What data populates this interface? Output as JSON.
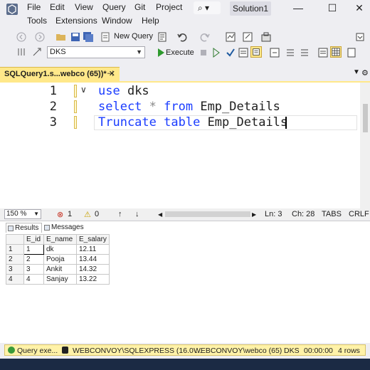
{
  "menu": {
    "items": [
      "File",
      "Edit",
      "View",
      "Query",
      "Git",
      "Project",
      "Tools",
      "Extensions",
      "Window",
      "Help"
    ],
    "search_label": "⌕ ▾",
    "solution_name": "Solution1"
  },
  "window": {
    "minimize": "—",
    "maximize": "☐",
    "close": "✕"
  },
  "toolbar": {
    "new_query_label": "New Query",
    "database_selected": "DKS",
    "execute_label": "Execute"
  },
  "tab": {
    "title": "SQLQuery1.s...webco (65))*",
    "pin": "⊣",
    "close": "✕"
  },
  "editor": {
    "lines": [
      {
        "number": "1",
        "keyword": "use",
        "rest": " dks"
      },
      {
        "number": "2",
        "keyword": "select",
        "op": " * ",
        "keyword2": "from",
        "rest": " Emp_Details"
      },
      {
        "number": "3",
        "keyword": "Truncate",
        "keyword2": "table",
        "rest": " Emp_Details "
      }
    ]
  },
  "editor_status": {
    "zoom": "150 %",
    "errors": "1",
    "warnings": "0",
    "line": "Ln: 3",
    "col": "Ch: 28",
    "tabs": "TABS",
    "eol": "CRLF"
  },
  "results": {
    "tabs": [
      "Results",
      "Messages"
    ],
    "columns": [
      "E_id",
      "E_name",
      "E_salary"
    ],
    "rows": [
      [
        "1",
        "1",
        "dk",
        "12.11"
      ],
      [
        "2",
        "2",
        "Pooja",
        "13.44"
      ],
      [
        "3",
        "3",
        "Ankit",
        "14.32"
      ],
      [
        "4",
        "4",
        "Sanjay",
        "13.22"
      ]
    ]
  },
  "statusbar": {
    "status": "Query  exe...",
    "server": "WEBCONVOY\\SQLEXPRESS (16.0 ...",
    "login": "WEBCONVOY\\webco (65)",
    "database": "DKS",
    "elapsed": "00:00:00",
    "rows": "4 rows"
  },
  "colors": {
    "tab_yellow": "#ffe88a",
    "keyword_blue": "#1a3cff",
    "status_yellow": "#fff2a8"
  }
}
